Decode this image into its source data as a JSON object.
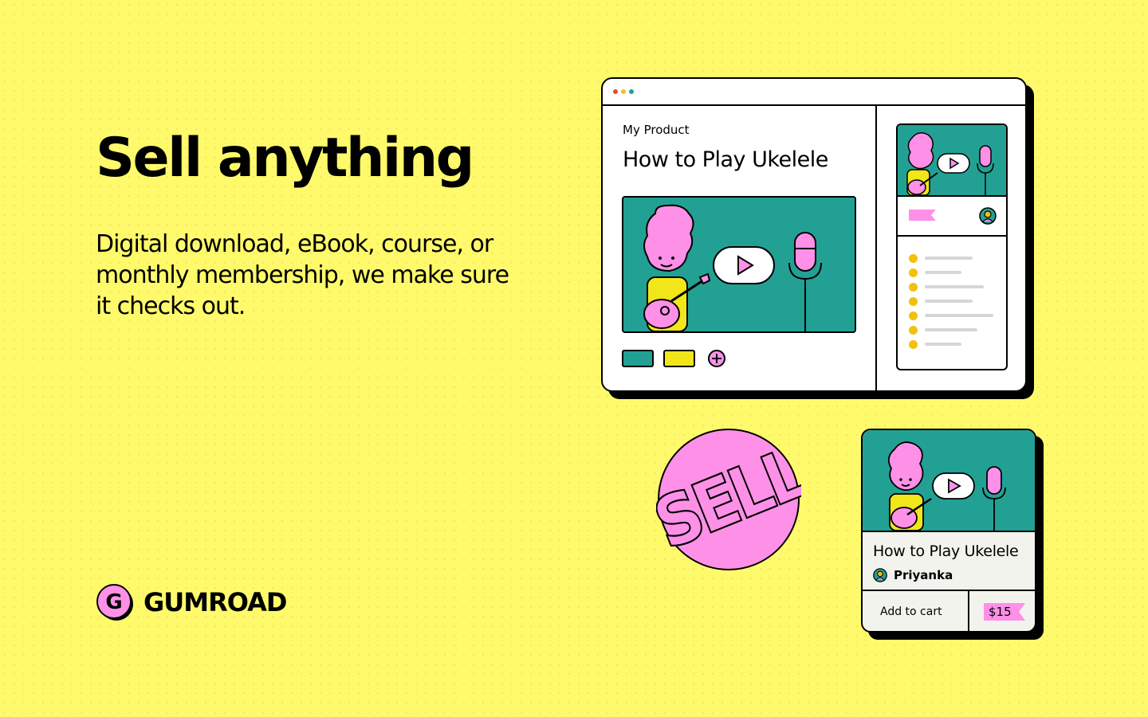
{
  "hero": {
    "headline": "Sell anything",
    "subtext": "Digital download, eBook, course, or monthly membership, we make sure it checks out."
  },
  "brand": {
    "logo_letter": "G",
    "name": "gumroad"
  },
  "browser_mock": {
    "product_label": "My Product",
    "product_title": "How to Play Ukelele",
    "window_dots": [
      "#e8483c",
      "#f2bf1f",
      "#23a094"
    ]
  },
  "sticker": {
    "text": "SELL"
  },
  "product_card": {
    "title": "How to Play Ukelele",
    "author": "Priyanka",
    "add_to_cart": "Add to cart",
    "price": "$15"
  },
  "colors": {
    "background": "#fffa6b",
    "teal": "#23a094",
    "pink": "#ff90e8",
    "yellow_accent": "#f0e61a",
    "list_dot": "#f0c20c"
  }
}
